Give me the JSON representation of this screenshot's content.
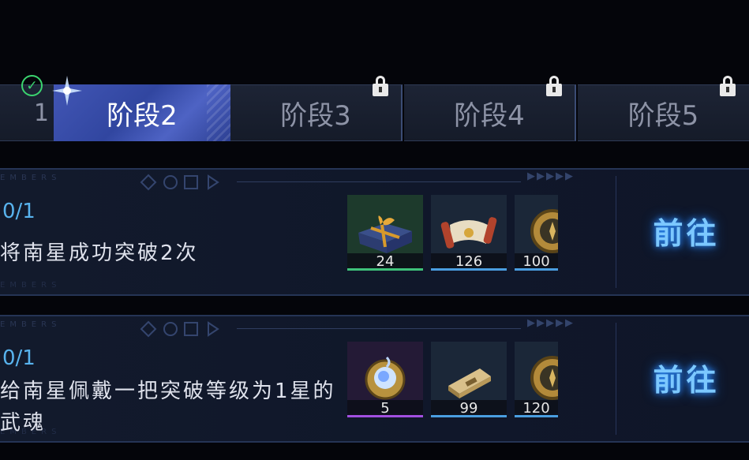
{
  "tabs": [
    {
      "label": "1"
    },
    {
      "label": "阶段2",
      "status": "completed"
    },
    {
      "label": "阶段3",
      "status": "locked"
    },
    {
      "label": "阶段4",
      "status": "locked"
    },
    {
      "label": "阶段5",
      "status": "locked"
    }
  ],
  "decor": {
    "members_text": "EMBERS",
    "arrows": "▶▶▶▶▶"
  },
  "tasks": [
    {
      "progress": "0/1",
      "description": "将南星成功突破2次",
      "rewards": [
        {
          "icon": "gift-box-icon",
          "count": "24",
          "rarity_color": "#3fc27a"
        },
        {
          "icon": "scroll-icon",
          "count": "126",
          "rarity_color": "#4a9ee0"
        },
        {
          "icon": "coin-icon",
          "count": "100",
          "rarity_color": "#4a9ee0"
        }
      ],
      "action": "前往"
    },
    {
      "progress": "0/1",
      "description_line1": "给南星佩戴一把突破等级为1星的",
      "description_line2": "武魂",
      "rewards": [
        {
          "icon": "spirit-orb-icon",
          "count": "5",
          "rarity_color": "#a24fe0"
        },
        {
          "icon": "gold-ingot-icon",
          "count": "99",
          "rarity_color": "#4a9ee0"
        },
        {
          "icon": "coin-icon",
          "count": "120",
          "rarity_color": "#4a9ee0"
        }
      ],
      "action": "前往"
    }
  ],
  "colors": {
    "accent": "#58b3ee",
    "tab_active": "#3a4eaf",
    "go_button": "#7cc8ff"
  }
}
